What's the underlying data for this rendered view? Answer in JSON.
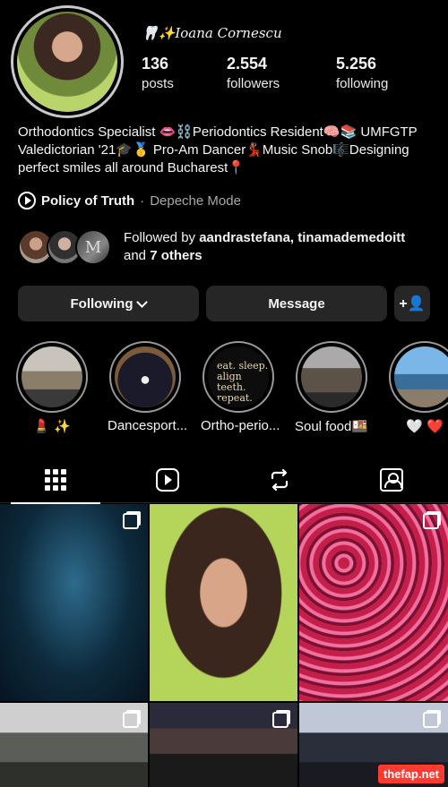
{
  "profile": {
    "name": "🦷✨Ioana Cornescu",
    "stats": [
      {
        "value": "136",
        "label": "posts"
      },
      {
        "value": "2.554",
        "label": "followers"
      },
      {
        "value": "5.256",
        "label": "following"
      }
    ],
    "bio": "Orthodontics Specialist 👄⛓️Periodontics Resident🧠📚 UMFGTP Valedictorian '21🎓🥇 Pro-Am Dancer💃🏽Music Snob🎼Designing perfect smiles all around Bucharest📍",
    "music": {
      "song": "Policy of Truth",
      "separator": " · ",
      "artist": "Depeche Mode"
    },
    "followed_by": {
      "prefix": "Followed by ",
      "names": "aandrastefana, tinamademedoitt",
      "and": " and ",
      "others": "7 others",
      "mini_letter": "M"
    }
  },
  "actions": {
    "following": "Following",
    "message": "Message",
    "add_user_icon": "+👤"
  },
  "highlights": [
    {
      "label": "💄 ✨"
    },
    {
      "label": "Dancesport..."
    },
    {
      "label": "Ortho-perio...",
      "cover_text": "eat. sleep. align teeth. repeat."
    },
    {
      "label": "Soul food🍱"
    },
    {
      "label": "🤍 ❤️"
    }
  ],
  "tabs": [
    "grid-icon",
    "reels-icon",
    "repost-icon",
    "tagged-icon"
  ],
  "watermark": "thefap.net"
}
